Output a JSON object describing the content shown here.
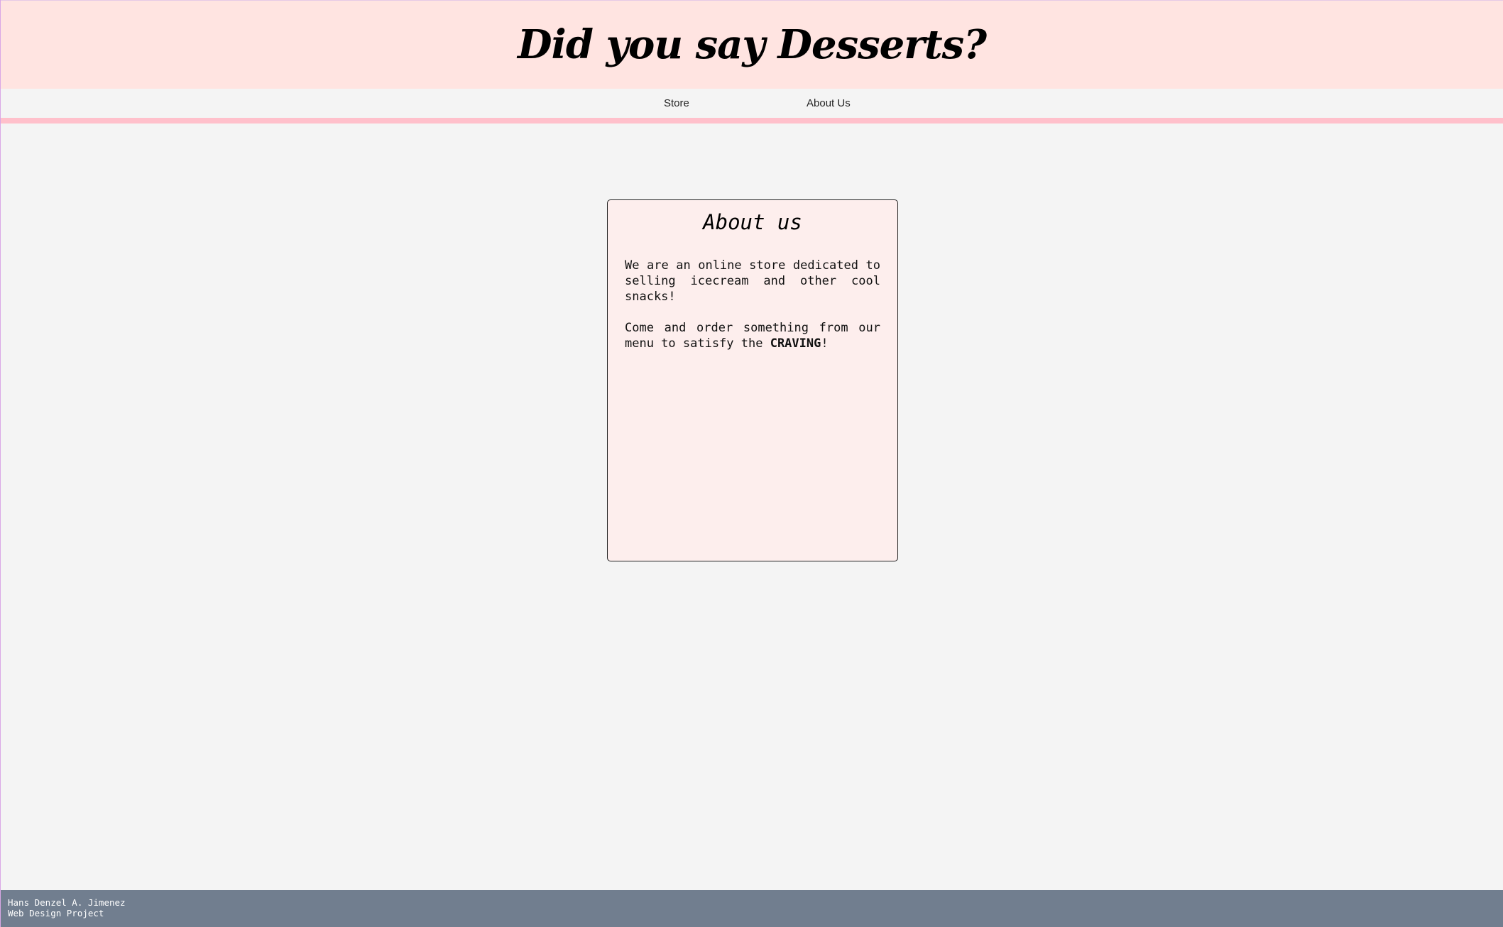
{
  "header": {
    "title": "Did you say Desserts?"
  },
  "nav": {
    "items": [
      {
        "label": "Store"
      },
      {
        "label": "About Us"
      }
    ]
  },
  "about": {
    "title": "About us",
    "paragraph1": "We are an online store dedicated to selling icecream and other cool snacks!",
    "paragraph2_before": "Come and order something from our menu to satisfy the ",
    "paragraph2_emphasis": "CRAVING",
    "paragraph2_after": "!"
  },
  "footer": {
    "author": "Hans Denzel A. Jimenez",
    "project": "Web Design Project"
  },
  "colors": {
    "header_bg": "#ffe4e1",
    "accent_rule": "#ffc0cb",
    "card_bg": "#fdeeed",
    "footer_bg": "#717e8f",
    "page_bg": "#f4f4f4"
  }
}
